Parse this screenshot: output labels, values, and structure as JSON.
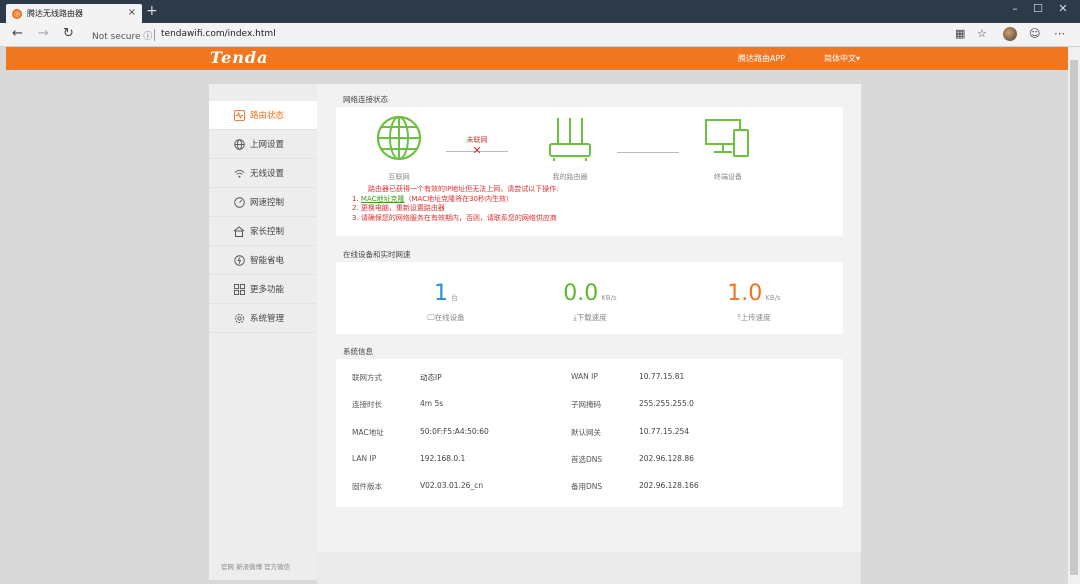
{
  "browser": {
    "tab_title": "腾达无线路由器",
    "tab_close": "×",
    "new_tab": "+",
    "not_secure": "Not secure",
    "url": "tendawifi.com/index.html",
    "window_controls": [
      "–",
      "☐",
      "✕"
    ]
  },
  "header": {
    "logo": "Tenda",
    "app_link": "腾达路由APP",
    "language": "简体中文▾",
    "accent": "#f07620"
  },
  "sidebar": {
    "items": [
      {
        "label": "路由状态",
        "icon": "pulse-icon",
        "active": true
      },
      {
        "label": "上网设置",
        "icon": "globe-icon",
        "active": false
      },
      {
        "label": "无线设置",
        "icon": "wifi-icon",
        "active": false
      },
      {
        "label": "网速控制",
        "icon": "speedometer-icon",
        "active": false
      },
      {
        "label": "家长控制",
        "icon": "home-icon",
        "active": false
      },
      {
        "label": "智能省电",
        "icon": "power-icon",
        "active": false
      },
      {
        "label": "更多功能",
        "icon": "grid-icon",
        "active": false
      },
      {
        "label": "系统管理",
        "icon": "gear-icon",
        "active": false
      }
    ],
    "footer": "官网  新浪微博  官方微信"
  },
  "network_status": {
    "title": "网络连接状态",
    "internet_label": "互联网",
    "router_label": "我的路由器",
    "devices_label": "终端设备",
    "disconnected_label": "未联网",
    "warnings": {
      "intro": "路由器已获得一个有效的IP地址但无法上网，请尝试以下操作:",
      "step1_prefix": "1. ",
      "step1_link": "MAC地址克隆",
      "step1_suffix": "（MAC地址克隆将在30秒内生效）",
      "step2": "2. 更换电脑，重新设置路由器",
      "step3": "3. 请确保您的网络服务在有效期内，否则，请联系您的网络供应商"
    }
  },
  "realtime": {
    "title": "在线设备和实时网速",
    "devices": {
      "value": "1",
      "unit": "台",
      "label": "在线设备",
      "color": "#2a8fd0"
    },
    "download": {
      "value": "0.0",
      "unit": "KB/s",
      "label": "下载速度",
      "color": "#5cb82c"
    },
    "upload": {
      "value": "1.0",
      "unit": "KB/s",
      "label": "上传速度",
      "color": "#f07620"
    }
  },
  "system_info": {
    "title": "系统信息",
    "left": [
      {
        "label": "联网方式",
        "value": "动态IP"
      },
      {
        "label": "连接时长",
        "value": "4m 5s"
      },
      {
        "label": "MAC地址",
        "value": "50:0F:F5:A4:50:60"
      },
      {
        "label": "LAN IP",
        "value": "192.168.0.1"
      },
      {
        "label": "固件版本",
        "value": "V02.03.01.26_cn"
      }
    ],
    "right": [
      {
        "label": "WAN IP",
        "value": "10.77.15.81"
      },
      {
        "label": "子网掩码",
        "value": "255.255.255.0"
      },
      {
        "label": "默认网关",
        "value": "10.77.15.254"
      },
      {
        "label": "首选DNS",
        "value": "202.96.128.86"
      },
      {
        "label": "备用DNS",
        "value": "202.96.128.166"
      }
    ]
  }
}
